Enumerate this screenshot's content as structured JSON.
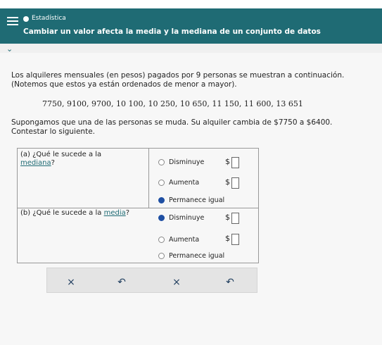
{
  "header": {
    "category": "Estadística",
    "subtitle": "Cambiar un valor afecta la media y la mediana de un conjunto de datos",
    "menu_icon": "hamburger-icon",
    "collapse_icon": "chevron-down-icon"
  },
  "problem": {
    "intro_line1": "Los alquileres mensuales (en pesos) pagados por 9 personas se muestran a continuación.",
    "intro_line2": "(Notemos que estos ya están ordenados de menor a mayor).",
    "data_values": "7750, 9100, 9700, 10 100, 10 250, 10 650, 11 150, 11 600, 13 651",
    "change_line": "Supongamos que una de las personas se muda. Su alquiler cambia de $7750 a $6400.",
    "instruction": "Contestar lo siguiente."
  },
  "questions": {
    "a": {
      "prefix": "(a)  ¿Qué le sucede a la",
      "term": "mediana",
      "suffix": "?",
      "options": [
        "Disminuye",
        "Aumenta",
        "Permanece igual"
      ],
      "selected": "Permanece igual"
    },
    "b": {
      "prefix": "(b)  ¿Qué le sucede a la",
      "term": "media",
      "suffix": "?",
      "options": [
        "Disminuye",
        "Aumenta",
        "Permanece igual"
      ],
      "selected": "Disminuye"
    },
    "currency": "$"
  },
  "buttons": {
    "clear_a": "×",
    "undo_a": "↶",
    "clear_b": "×",
    "undo_b": "↶"
  },
  "colors": {
    "header_bg": "#1f6b74",
    "radio_selected": "#1e4fa3"
  }
}
